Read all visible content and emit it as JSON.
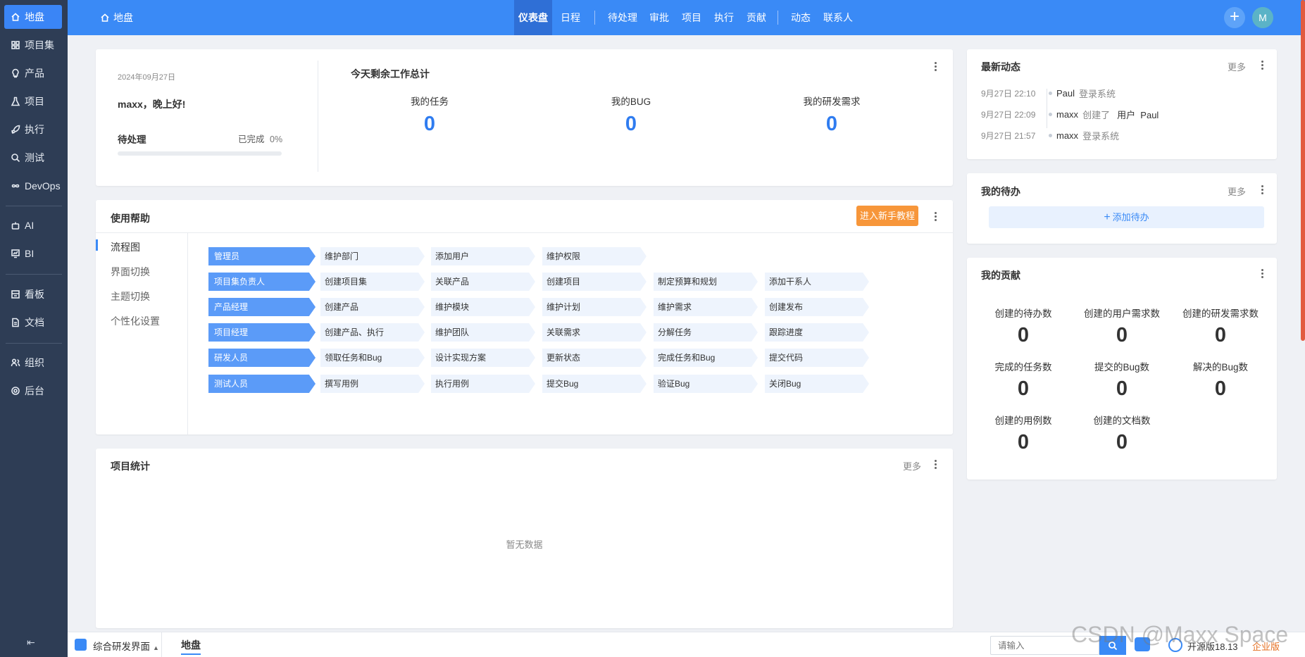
{
  "sidebar": {
    "items": [
      {
        "label": "地盘",
        "icon": "home-icon",
        "active": true
      },
      {
        "label": "项目集",
        "icon": "grid-icon"
      },
      {
        "label": "产品",
        "icon": "bulb-icon"
      },
      {
        "label": "项目",
        "icon": "flask-icon"
      },
      {
        "label": "执行",
        "icon": "rocket-icon"
      },
      {
        "label": "测试",
        "icon": "search-icon"
      },
      {
        "label": "DevOps",
        "icon": "infinity-icon"
      },
      {
        "label": "AI",
        "icon": "robot-icon"
      },
      {
        "label": "BI",
        "icon": "chart-board-icon"
      },
      {
        "label": "看板",
        "icon": "board-icon"
      },
      {
        "label": "文档",
        "icon": "doc-icon"
      },
      {
        "label": "组织",
        "icon": "people-icon"
      },
      {
        "label": "后台",
        "icon": "gear-icon"
      }
    ],
    "collapse_glyph": "⇤"
  },
  "topbar": {
    "breadcrumb": "地盘",
    "nav": [
      "仪表盘",
      "日程",
      "待处理",
      "审批",
      "项目",
      "执行",
      "贡献",
      "动态",
      "联系人"
    ],
    "plus": "+",
    "avatar": "M"
  },
  "welcome": {
    "date": "2024年09月27日",
    "greeting": "maxx，晚上好!",
    "pending_label": "待处理",
    "done_label": "已完成",
    "done_percent": "0%",
    "progress": 0
  },
  "summary": {
    "title": "今天剩余工作总计",
    "stats": [
      {
        "label": "我的任务",
        "value": "0"
      },
      {
        "label": "我的BUG",
        "value": "0"
      },
      {
        "label": "我的研发需求",
        "value": "0"
      }
    ]
  },
  "help": {
    "title": "使用帮助",
    "tutorial_button": "进入新手教程",
    "tabs": [
      "流程图",
      "界面切换",
      "主题切换",
      "个性化设置"
    ],
    "roles": [
      {
        "role": "管理员",
        "steps": [
          "维护部门",
          "添加用户",
          "维护权限"
        ]
      },
      {
        "role": "项目集负责人",
        "steps": [
          "创建项目集",
          "关联产品",
          "创建项目",
          "制定预算和规划",
          "添加干系人"
        ]
      },
      {
        "role": "产品经理",
        "steps": [
          "创建产品",
          "维护模块",
          "维护计划",
          "维护需求",
          "创建发布"
        ]
      },
      {
        "role": "项目经理",
        "steps": [
          "创建产品、执行",
          "维护团队",
          "关联需求",
          "分解任务",
          "跟踪进度"
        ]
      },
      {
        "role": "研发人员",
        "steps": [
          "领取任务和Bug",
          "设计实现方案",
          "更新状态",
          "完成任务和Bug",
          "提交代码"
        ]
      },
      {
        "role": "测试人员",
        "steps": [
          "撰写用例",
          "执行用例",
          "提交Bug",
          "验证Bug",
          "关闭Bug"
        ]
      }
    ]
  },
  "project_stats": {
    "title": "项目统计",
    "more": "更多",
    "empty": "暂无数据"
  },
  "activity": {
    "title": "最新动态",
    "more": "更多",
    "items": [
      {
        "time": "9月27日 22:10",
        "user": "Paul",
        "verb": "登录系统",
        "object": ""
      },
      {
        "time": "9月27日 22:09",
        "user": "maxx",
        "verb": "创建了",
        "object": "用户  Paul"
      },
      {
        "time": "9月27日 21:57",
        "user": "maxx",
        "verb": "登录系统",
        "object": ""
      }
    ]
  },
  "todo": {
    "title": "我的待办",
    "more": "更多",
    "add_label": "添加待办"
  },
  "contrib": {
    "title": "我的贡献",
    "stats": [
      {
        "label": "创建的待办数",
        "value": "0"
      },
      {
        "label": "创建的用户需求数",
        "value": "0"
      },
      {
        "label": "创建的研发需求数",
        "value": "0"
      },
      {
        "label": "完成的任务数",
        "value": "0"
      },
      {
        "label": "提交的Bug数",
        "value": "0"
      },
      {
        "label": "解决的Bug数",
        "value": "0"
      },
      {
        "label": "创建的用例数",
        "value": "0"
      },
      {
        "label": "创建的文档数",
        "value": "0"
      }
    ]
  },
  "bottombar": {
    "app_label": "综合研发界面",
    "current_tab": "地盘",
    "search_placeholder": "请输入",
    "version": "开源版18.13",
    "edition_link": "企业版",
    "watermark": "CSDN @Maxx Space"
  },
  "colors": {
    "accent": "#3a8af6",
    "sidebar": "#2e3d55",
    "orange": "#f7963a",
    "stat_blue": "#2f7cf0"
  }
}
